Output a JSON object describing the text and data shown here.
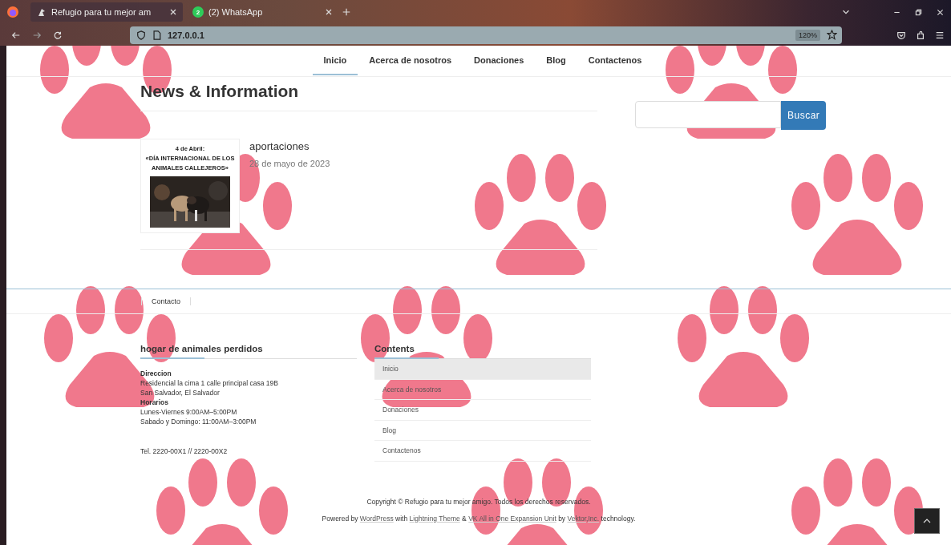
{
  "browser": {
    "tabs": [
      {
        "title": "Refugio para tu mejor am",
        "selected": true,
        "kind": "site"
      },
      {
        "title": "(2) WhatsApp",
        "selected": false,
        "kind": "whatsapp",
        "badge": "2"
      }
    ],
    "url": "127.0.0.1",
    "zoom": "120%"
  },
  "nav": [
    {
      "label": "Inicio",
      "selected": true
    },
    {
      "label": "Acerca de nosotros",
      "selected": false
    },
    {
      "label": "Donaciones",
      "selected": false
    },
    {
      "label": "Blog",
      "selected": false
    },
    {
      "label": "Contactenos",
      "selected": false
    }
  ],
  "heading": "News & Information",
  "posts": [
    {
      "title": "aportaciones",
      "date": "28 de mayo de 2023",
      "thumbnail": {
        "lines": [
          "4 de Abril:",
          "«DÍA INTERNACIONAL DE LOS",
          "ANIMALES CALLEJEROS»"
        ]
      }
    }
  ],
  "search": {
    "button": "Buscar"
  },
  "footer_nav": [
    "Contacto"
  ],
  "widgets": {
    "about": {
      "title": "hogar de animales perdidos",
      "lines": [
        {
          "text": "Direccion",
          "kind": "label"
        },
        {
          "text": "Residencial la cima 1 calle principal casa 19B",
          "kind": "text"
        },
        {
          "text": "San Salvador, El Salvador",
          "kind": "text"
        },
        {
          "text": "Horarios",
          "kind": "label"
        },
        {
          "text": "Lunes-Viernes 9:00AM–5:00PM",
          "kind": "text"
        },
        {
          "text": "Sabado y Domingo: 11:00AM–3:00PM",
          "kind": "text"
        }
      ],
      "phone": "Tel. 2220-00X1 // 2220-00X2"
    },
    "contents": {
      "title": "Contents",
      "items": [
        {
          "label": "Inicio",
          "selected": true
        },
        {
          "label": "Acerca de nosotros",
          "selected": false
        },
        {
          "label": "Donaciones",
          "selected": false
        },
        {
          "label": "Blog",
          "selected": false
        },
        {
          "label": "Contactenos",
          "selected": false
        }
      ]
    }
  },
  "copyright": "Copyright © Refugio para tu mejor amigo. Todos los derechos reservados.",
  "powered_by": [
    {
      "text": "Powered by ",
      "kind": "text"
    },
    {
      "text": "WordPress",
      "kind": "link"
    },
    {
      "text": " with ",
      "kind": "text"
    },
    {
      "text": "Lightning Theme",
      "kind": "link"
    },
    {
      "text": " & ",
      "kind": "text"
    },
    {
      "text": "VK All in One Expansion Unit",
      "kind": "link"
    },
    {
      "text": " by ",
      "kind": "text"
    },
    {
      "text": "Vektor,Inc.",
      "kind": "link"
    },
    {
      "text": " technology.",
      "kind": "text"
    }
  ]
}
